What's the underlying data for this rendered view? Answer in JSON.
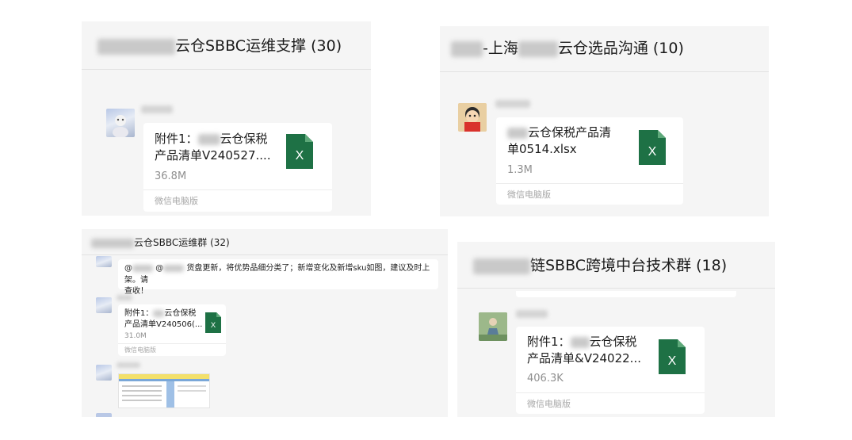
{
  "panels": [
    {
      "title_suffix": "云仓SBBC运维支撑 (30)",
      "card": {
        "name": "附件1：[blurred]云仓保税产品清单V240527....",
        "name_line1": "附件1：",
        "name_line1b": "云仓保税",
        "name_line2": "产品清单V240527....",
        "size": "36.8M",
        "source": "微信电脑版"
      }
    },
    {
      "title_prefix": "-上海",
      "title_suffix": "云仓选品沟通 (10)",
      "card": {
        "name_line1": "云仓保税产品清",
        "name_line2": "单0514.xlsx",
        "size": "1.3M",
        "source": "微信电脑版"
      }
    },
    {
      "title_suffix": "云仓SBBC运维群 (32)",
      "message": {
        "text_line1": "货盘更新，将优势品细分类了；新增变化及新增sku如图，建议及时上架。请",
        "text_line2": "查收！",
        "mention": "@"
      },
      "card": {
        "name_line1": "附件1：",
        "name_line1b": "云仓保税",
        "name_line2": "产品清单V240506(...",
        "size": "31.0M",
        "source": "微信电脑版"
      }
    },
    {
      "title_suffix": "链SBBC跨境中台技术群 (18)",
      "card": {
        "name_line1": "附件1：",
        "name_line1b": "云仓保税",
        "name_line2": "产品清单&V24022...",
        "size": "406.3K",
        "source": "微信电脑版"
      }
    }
  ],
  "icons": {
    "file": "excel-file-icon"
  },
  "colors": {
    "excel_green": "#1e7145",
    "panel_bg": "#f5f5f5",
    "muted": "#8f8f8f"
  }
}
